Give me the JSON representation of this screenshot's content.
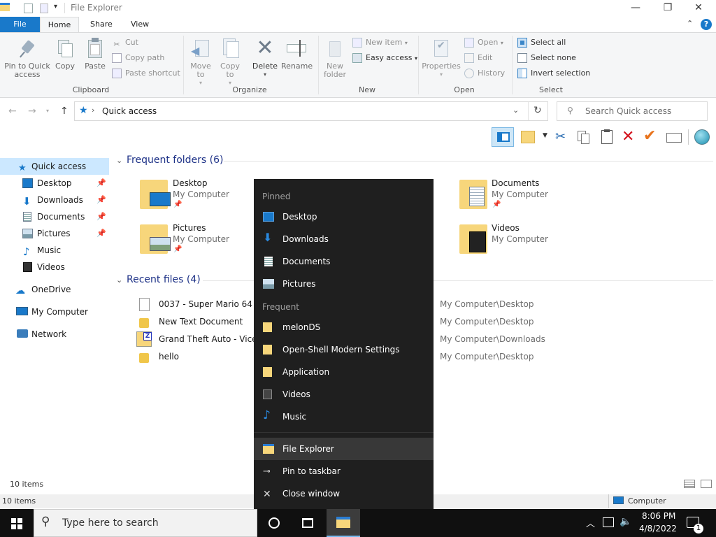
{
  "window": {
    "title": "File Explorer"
  },
  "ribbon_tabs": [
    "File",
    "Home",
    "Share",
    "View"
  ],
  "clipboard": {
    "pin_label": "Pin to Quick access",
    "copy_label": "Copy",
    "paste_label": "Paste",
    "cut_label": "Cut",
    "copy_path_label": "Copy path",
    "paste_shortcut_label": "Paste shortcut",
    "group_label": "Clipboard"
  },
  "organize": {
    "move_to_label": "Move to",
    "copy_to_label": "Copy to",
    "delete_label": "Delete",
    "rename_label": "Rename",
    "group_label": "Organize"
  },
  "new_group": {
    "new_folder_label": "New folder",
    "new_item_label": "New item",
    "easy_access_label": "Easy access",
    "group_label": "New"
  },
  "open_group": {
    "properties_label": "Properties",
    "open_label": "Open",
    "edit_label": "Edit",
    "history_label": "History",
    "group_label": "Open"
  },
  "select_group": {
    "select_all_label": "Select all",
    "select_none_label": "Select none",
    "invert_label": "Invert selection",
    "group_label": "Select"
  },
  "address": {
    "path": "Quick access",
    "search_placeholder": "Search Quick access"
  },
  "nav_pane": {
    "quick_access": "Quick access",
    "items": [
      "Desktop",
      "Downloads",
      "Documents",
      "Pictures",
      "Music",
      "Videos"
    ],
    "onedrive": "OneDrive",
    "my_computer": "My Computer",
    "network": "Network"
  },
  "frequent": {
    "header": "Frequent folders (6)",
    "folders": [
      {
        "name": "Desktop",
        "location": "My Computer"
      },
      {
        "name": "Pictures",
        "location": "My Computer"
      },
      {
        "name": "Documents",
        "location": "My Computer"
      },
      {
        "name": "Videos",
        "location": "My Computer"
      }
    ]
  },
  "recent": {
    "header": "Recent files (4)",
    "files": [
      {
        "name": "0037 - Super Mario 64 DS (U",
        "path": "My Computer\\Desktop"
      },
      {
        "name": "New Text Document",
        "path": "My Computer\\Desktop"
      },
      {
        "name": "Grand Theft Auto - Vice C",
        "path": "My Computer\\Downloads"
      },
      {
        "name": "hello",
        "path": "My Computer\\Desktop"
      }
    ]
  },
  "status": {
    "items_top": "10 items",
    "items_bottom": "10 items",
    "location": "Computer"
  },
  "jump_list": {
    "pinned_header": "Pinned",
    "pinned": [
      "Desktop",
      "Downloads",
      "Documents",
      "Pictures"
    ],
    "frequent_header": "Frequent",
    "frequent": [
      "melonDS",
      "Open-Shell Modern Settings",
      "Application",
      "Videos",
      "Music"
    ],
    "actions": [
      "File Explorer",
      "Pin to taskbar",
      "Close window"
    ]
  },
  "taskbar": {
    "search_placeholder": "Type here to search",
    "time": "8:06 PM",
    "date": "4/8/2022",
    "notification_count": "1"
  },
  "colors": {
    "accent": "#1979ca",
    "folder": "#f7d67b",
    "jumplist_bg": "#1f1f1f",
    "taskbar_bg": "#101010"
  }
}
